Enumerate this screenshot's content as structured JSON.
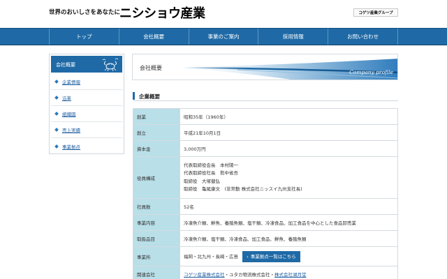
{
  "header": {
    "tagline": "世界のおいしさをあなたに",
    "logo": "ニシショウ産業",
    "group_logo": "コゲツ産業グループ"
  },
  "nav": {
    "items": [
      {
        "label": "トップ"
      },
      {
        "label": "会社概要"
      },
      {
        "label": "事業のご案内"
      },
      {
        "label": "採用情報"
      },
      {
        "label": "お問い合わせ"
      }
    ]
  },
  "sidebar": {
    "heading": "会社概要",
    "items": [
      {
        "label": "企業情報"
      },
      {
        "label": "沿革"
      },
      {
        "label": "組織図"
      },
      {
        "label": "売上実績"
      },
      {
        "label": "事業拠点"
      }
    ]
  },
  "banner": {
    "title": "会社概要",
    "subtitle": "Company profile"
  },
  "section": {
    "title": "企業概要"
  },
  "table": {
    "founded_label": "創業",
    "founded_value": "昭和35年（1960年）",
    "established_label": "創立",
    "established_value": "平成21年10月1日",
    "capital_label": "資本金",
    "capital_value": "3,000万円",
    "officers_label": "役員構成",
    "officers": [
      "代表取締役会長　本村陽一",
      "代表取締役社長　熊中省吾",
      "取締役　大塚健弘",
      "取締役　亀尾康文　(非常勤 株式会社ニッスイ九州支社長)"
    ],
    "employees_label": "社員数",
    "employees_value": "52名",
    "business_label": "事業内容",
    "business_value": "冷凍魚介類、鮮魚、養殖魚類、塩干類、冷凍食品、加工食品を中心とした食品卸売業",
    "products_label": "取扱品目",
    "products_value": "冷凍魚介類、塩干類、冷凍食品、加工食品、鮮魚、養殖魚類",
    "offices_label": "事業所",
    "offices_value": "福岡・北九州・長崎・広島",
    "offices_button": "事業拠点一覧はこちら",
    "related_label": "関連会社",
    "related_link1": "コゲツ産業株式会社",
    "related_sep1": "・ユタカ物流株式会社・",
    "related_link2": "株式会社湖月堂"
  },
  "colors": {
    "nav_blue": "#1f6aa6",
    "table_key_bg": "#b9dfe8",
    "link": "#1f5fa0"
  }
}
